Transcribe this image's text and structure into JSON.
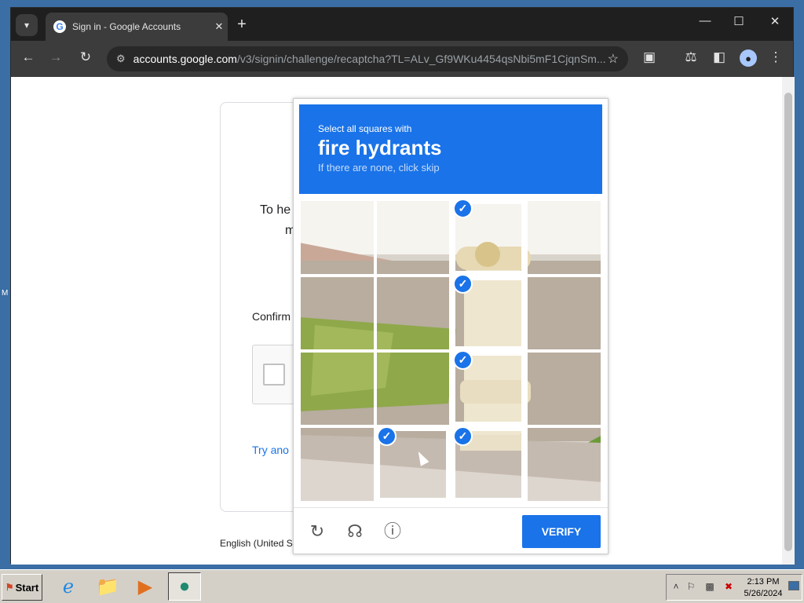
{
  "browser": {
    "tab_title": "Sign in - Google Accounts",
    "url_host": "accounts.google.com",
    "url_path": "/v3/signin/challenge/recaptcha?TL=ALv_Gf9WKu4454qsNbi5mF1CjqnSm...",
    "icons": [
      "tab-search-icon",
      "google-favicon",
      "close-icon",
      "new-tab-icon",
      "minimize-icon",
      "maximize-icon",
      "close-window-icon",
      "back-icon",
      "forward-icon",
      "reload-icon",
      "site-info-icon",
      "bookmark-star-icon",
      "extensions-icon",
      "labs-icon",
      "side-panel-icon",
      "profile-icon",
      "menu-icon"
    ]
  },
  "signin": {
    "help_text_fragment": "To he",
    "help_text_fragment2": "m",
    "confirm_label": "Confirm",
    "try_another": "Try ano",
    "language": "English (United S"
  },
  "captcha": {
    "instruction_small": "Select all squares with",
    "target": "fire hydrants",
    "skip_hint": "If there are none, click skip",
    "verify_label": "VERIFY",
    "grid": {
      "rows": 4,
      "cols": 4
    },
    "selected_tiles": [
      [
        0,
        2
      ],
      [
        1,
        2
      ],
      [
        2,
        2
      ],
      [
        3,
        1
      ],
      [
        3,
        2
      ]
    ],
    "colors": {
      "accent": "#1a73e8",
      "header_text": "#ffffff"
    }
  },
  "desktop": {
    "edge_letter": "M"
  },
  "taskbar": {
    "start_label": "Start",
    "time": "2:13 PM",
    "date": "5/26/2024",
    "apps": [
      "internet-explorer-icon",
      "file-explorer-icon",
      "media-player-icon",
      "edge-browser-icon"
    ]
  }
}
